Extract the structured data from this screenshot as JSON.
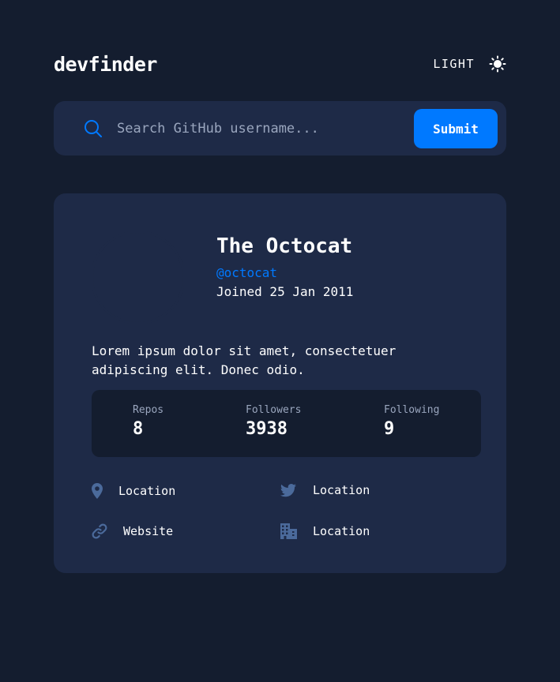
{
  "header": {
    "logo": "devfinder",
    "theme_label": "LIGHT",
    "theme_icon": "sun-icon"
  },
  "search": {
    "placeholder": "Search GitHub username...",
    "value": "",
    "submit_label": "Submit",
    "icon": "search-icon"
  },
  "profile": {
    "name": "The Octocat",
    "login": "@octocat",
    "joined": "Joined 25 Jan 2011",
    "bio": "Lorem ipsum dolor sit amet, consectetuer adipiscing elit. Donec odio."
  },
  "stats": {
    "repos_label": "Repos",
    "repos_value": "8",
    "followers_label": "Followers",
    "followers_value": "3938",
    "following_label": "Following",
    "following_value": "9"
  },
  "links": {
    "location": "Location",
    "twitter": "Location",
    "website": "Website",
    "company": "Location"
  },
  "colors": {
    "background": "#141d2f",
    "card": "#1e2a47",
    "accent": "#0079ff",
    "icon": "#4b6a9b",
    "muted": "#9aa6be"
  }
}
